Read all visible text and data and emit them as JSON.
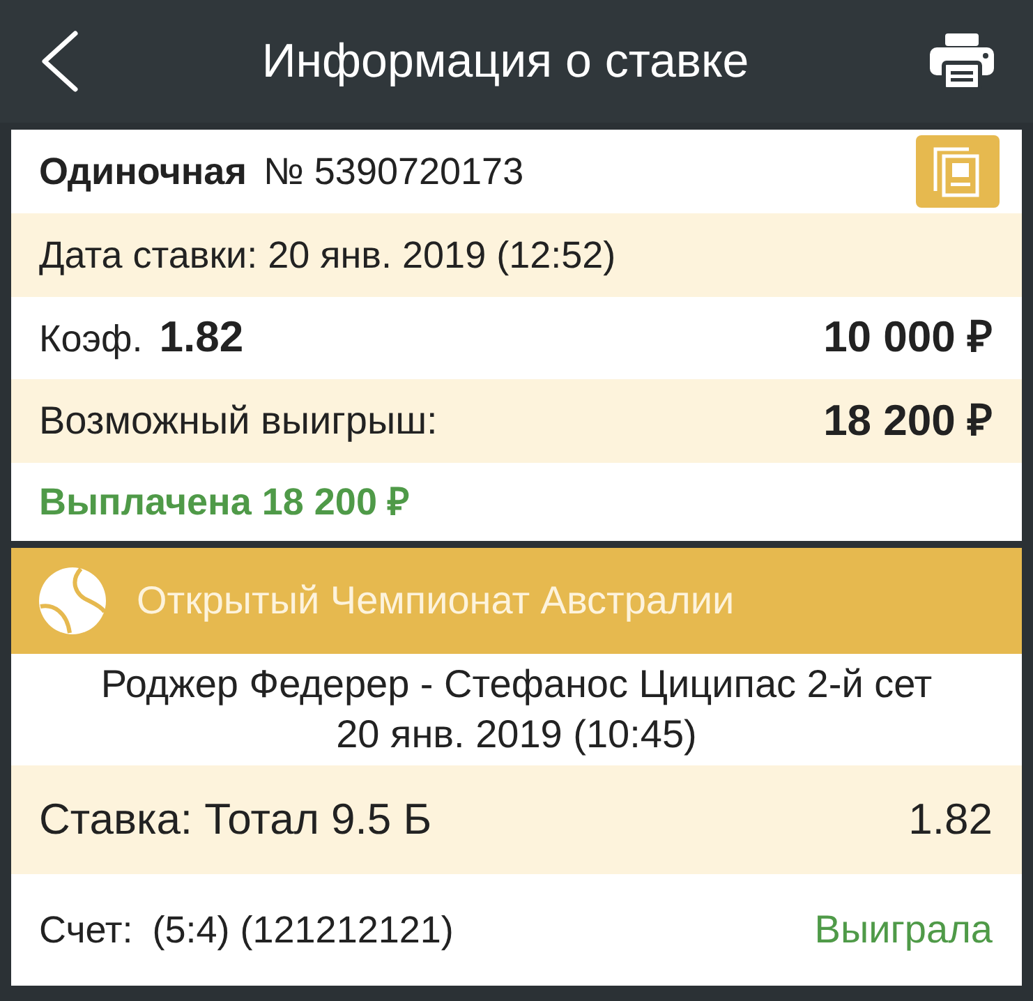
{
  "header": {
    "title": "Информация о ставке"
  },
  "bet": {
    "type": "Одиночная",
    "number": "№ 5390720173",
    "date": "Дата ставки: 20 янв. 2019 (12:52)",
    "odds_label": "Коэф.",
    "odds": "1.82",
    "stake": "10 000 ₽",
    "possible_win_label": "Возможный выигрыш:",
    "possible_win": "18 200 ₽",
    "paid": "Выплачена 18 200 ₽"
  },
  "event": {
    "tournament": "Открытый Чемпионат Австралии",
    "match": "Роджер Федерер - Стефанос Циципас 2-й сет",
    "date": "20 янв. 2019 (10:45)",
    "selection": "Ставка: Тотал 9.5 Б",
    "selection_odds": "1.82",
    "score_label": "Счет:",
    "score": "(5:4) (121212121)",
    "result": "Выиграла"
  }
}
